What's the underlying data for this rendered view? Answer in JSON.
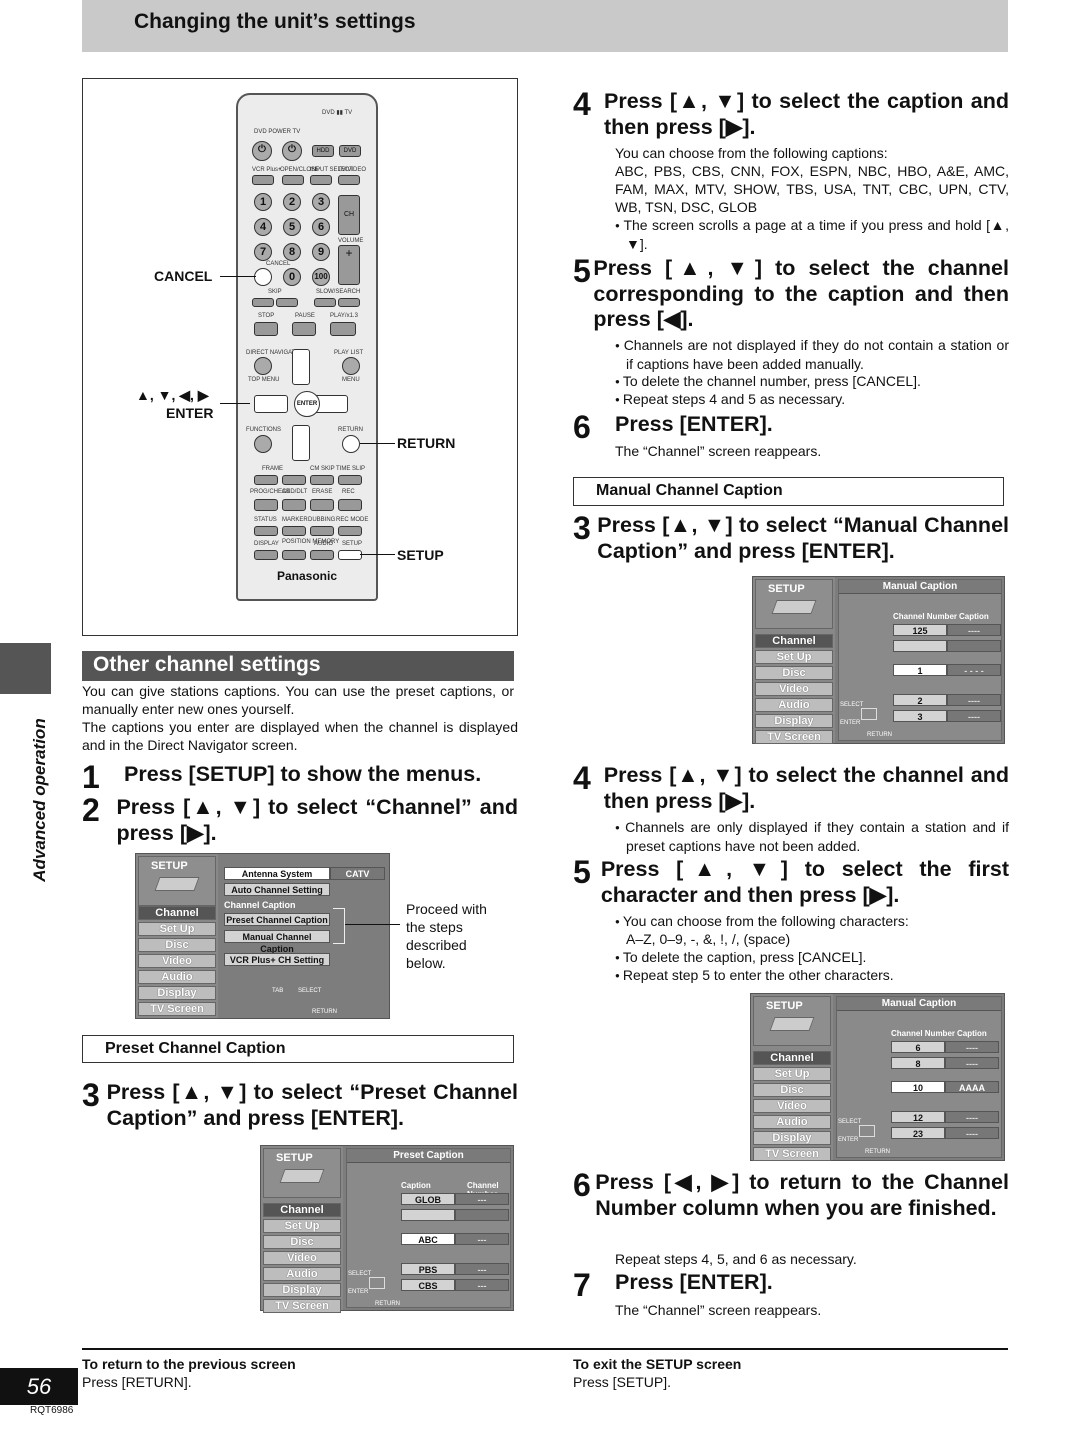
{
  "header": {
    "title": "Changing the unit’s settings"
  },
  "side_tab": {
    "label": "Advanced operation"
  },
  "page": {
    "number": "56",
    "code": "RQT6986"
  },
  "remote": {
    "brand": "Panasonic",
    "callouts": {
      "cancel": "CANCEL",
      "arrows": "▲, ▼, ◀, ▶",
      "enter": "ENTER",
      "return": "RETURN",
      "setup": "SETUP"
    },
    "labels": {
      "dvdtv": "DVD ▮▮ TV",
      "power": "DVD POWER TV",
      "hdd": "HDD",
      "dvd": "DVD",
      "vcrplus": "VCR Plus+",
      "openclose": "OPEN/CLOSE",
      "inputselect": "INPUT SELECT",
      "tvvideo": "TV/VIDEO",
      "ch": "CH",
      "volume": "VOLUME",
      "cancel": "CANCEL",
      "skip": "SKIP",
      "slowsearch": "SLOW/SEARCH",
      "stop": "STOP",
      "pause": "PAUSE",
      "play": "PLAY/x1.3",
      "directnav": "DIRECT NAVIGATOR",
      "topmenu": "TOP MENU",
      "playlist": "PLAY LIST",
      "menu": "MENU",
      "enter": "ENTER",
      "functions": "FUNCTIONS",
      "return": "RETURN",
      "frame": "FRAME",
      "cmskip": "CM SKIP",
      "timeslip": "TIME SLIP",
      "progcheck": "PROG/CHECK",
      "adddlt": "ADD/DLT",
      "erase": "ERASE",
      "rec": "REC",
      "status": "STATUS",
      "marker": "MARKER",
      "dubbing": "DUBBING",
      "recmode": "REC MODE",
      "display": "DISPLAY",
      "posmem": "POSITION MEMORY",
      "audio": "AUDIO",
      "setup": "SETUP"
    },
    "digits": [
      "1",
      "2",
      "3",
      "4",
      "5",
      "6",
      "7",
      "8",
      "9",
      "0",
      "100"
    ]
  },
  "left": {
    "section_title": "Other channel settings",
    "intro1": "You can give stations captions. You can use the preset captions, or manually enter new ones yourself.",
    "intro2": "The captions you enter are displayed when the channel is displayed and in the Direct Navigator screen.",
    "steps": [
      {
        "n": "1",
        "text": "Press [SETUP] to show the menus."
      },
      {
        "n": "2",
        "text": "Press [▲, ▼] to select “Channel” and press [▶]."
      }
    ],
    "proceed_note": "Proceed with the steps described below.",
    "preset_heading": "Preset Channel Caption",
    "preset_step": {
      "n": "3",
      "text": "Press [▲, ▼] to select “Preset Channel Caption” and press [ENTER]."
    }
  },
  "screens": {
    "menu": [
      "Channel",
      "Set Up",
      "Disc",
      "Video",
      "Audio",
      "Display",
      "TV Screen"
    ],
    "setup_label": "SETUP",
    "channel_screen": {
      "antenna": "Antenna System",
      "antenna_value": "CATV",
      "auto": "Auto Channel Setting",
      "caption_group": "Channel Caption",
      "preset": "Preset Channel Caption",
      "manual": "Manual Channel Caption",
      "vcrplus": "VCR Plus+ CH Setting",
      "nav_tab": "TAB",
      "nav_select": "SELECT",
      "nav_return": "RETURN"
    },
    "preset_screen": {
      "title": "Preset Caption",
      "col1": "Caption",
      "col2": "Channel Number",
      "rows": [
        [
          "GLOB",
          "---"
        ],
        [
          "",
          ""
        ],
        [
          "ABC",
          "---"
        ],
        [
          "PBS",
          "---"
        ],
        [
          "CBS",
          "---"
        ]
      ],
      "nav_select": "SELECT",
      "nav_enter": "ENTER",
      "nav_return": "RETURN"
    },
    "manual_screen1": {
      "title": "Manual Caption",
      "col1": "Channel Number",
      "col2": "Caption",
      "rows": [
        [
          "125",
          "----"
        ],
        [
          "",
          ""
        ],
        [
          "1",
          "- - - -"
        ],
        [
          "2",
          "----"
        ],
        [
          "3",
          "----"
        ]
      ],
      "nav_select": "SELECT",
      "nav_enter": "ENTER",
      "nav_return": "RETURN"
    },
    "manual_screen2": {
      "title": "Manual Caption",
      "col1": "Channel Number",
      "col2": "Caption",
      "rows": [
        [
          "6",
          "----"
        ],
        [
          "8",
          "----"
        ],
        [
          "10",
          "AAAA"
        ],
        [
          "12",
          "----"
        ],
        [
          "23",
          "----"
        ]
      ],
      "nav_select": "SELECT",
      "nav_enter": "ENTER",
      "nav_return": "RETURN"
    }
  },
  "right": {
    "s4": {
      "n": "4",
      "text": "Press [▲, ▼] to select the caption and then press [▶]."
    },
    "s4_p": "You can choose from the following captions:",
    "s4_list": "ABC, PBS, CBS, CNN, FOX, ESPN, NBC, HBO, A&E, AMC, FAM, MAX, MTV, SHOW, TBS, USA, TNT, CBC, UPN, CTV, WB, TSN, DSC, GLOB",
    "s4_b1": "The screen scrolls a page at a time if you press and hold [▲, ▼].",
    "s5": {
      "n": "5",
      "text": "Press [▲, ▼] to select the channel corresponding to the caption and then press [◀]."
    },
    "s5_b1": "Channels are not displayed if they do not contain a station or if captions have been added manually.",
    "s5_b2": "To delete the channel number, press [CANCEL].",
    "s5_b3": "Repeat steps 4 and 5 as necessary.",
    "s6": {
      "n": "6",
      "text": "Press [ENTER]."
    },
    "s6_p": "The “Channel” screen reappears.",
    "manual_heading": "Manual Channel Caption",
    "m3": {
      "n": "3",
      "text": "Press [▲, ▼] to select “Manual Channel Caption” and press [ENTER]."
    },
    "m4": {
      "n": "4",
      "text": "Press [▲, ▼] to select the channel and then press [▶]."
    },
    "m4_b1": "Channels are only displayed if they contain a station and if preset captions have not been added.",
    "m5": {
      "n": "5",
      "text": "Press [▲, ▼] to select the first character and then press [▶]."
    },
    "m5_b1": "You can choose from the following characters:",
    "m5_chars": "A–Z, 0–9, -, &, !, /, (space)",
    "m5_b2": "To delete the caption, press [CANCEL].",
    "m5_b3": "Repeat step 5 to enter the other characters.",
    "m6": {
      "n": "6",
      "text": "Press [◀, ▶] to return to the Channel Number column when you are finished."
    },
    "m6_p": "Repeat steps 4, 5, and 6 as necessary.",
    "m7": {
      "n": "7",
      "text": "Press [ENTER]."
    },
    "m7_p": "The “Channel” screen reappears."
  },
  "footer": {
    "left_title": "To return to the previous screen",
    "left_text": "Press [RETURN].",
    "right_title": "To exit the SETUP screen",
    "right_text": "Press [SETUP]."
  }
}
